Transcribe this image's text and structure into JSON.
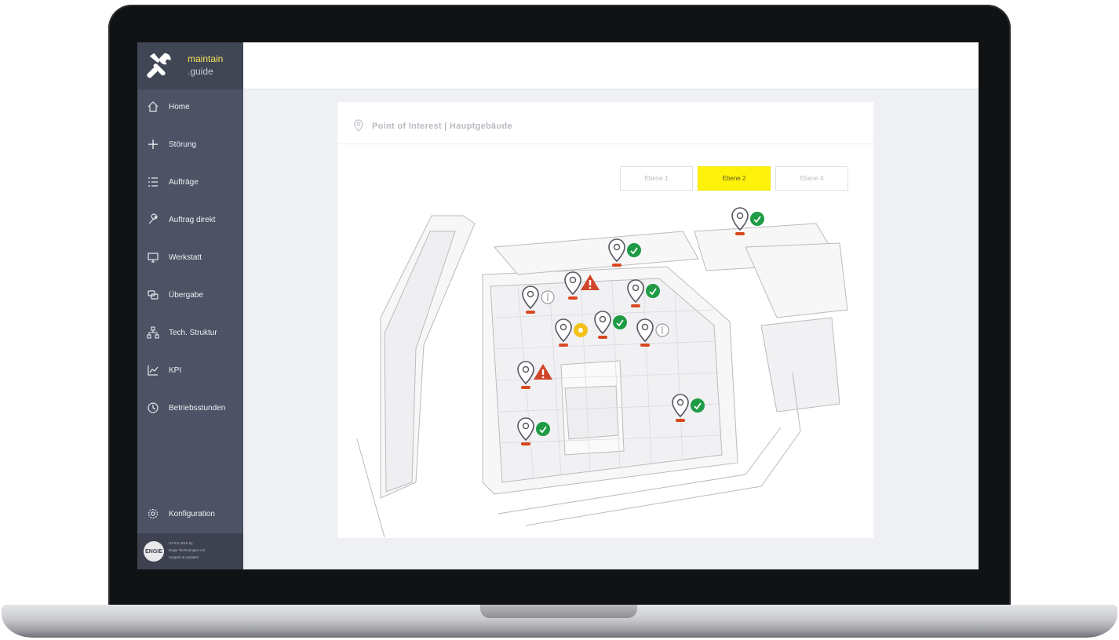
{
  "app": {
    "logo_line1": "maintain",
    "logo_line2": ".guide"
  },
  "sidebar": {
    "items": [
      {
        "label": "Home",
        "icon": "home-icon"
      },
      {
        "label": "Störung",
        "icon": "plus-icon"
      },
      {
        "label": "Aufträge",
        "icon": "list-icon"
      },
      {
        "label": "Auftrag direkt",
        "icon": "wrench-icon"
      },
      {
        "label": "Werkstatt",
        "icon": "monitor-icon"
      },
      {
        "label": "Übergabe",
        "icon": "handover-icon"
      },
      {
        "label": "Tech. Struktur",
        "icon": "hierarchy-icon"
      },
      {
        "label": "KPI",
        "icon": "chart-icon"
      },
      {
        "label": "Betriebsstunden",
        "icon": "clock-icon"
      }
    ],
    "config_label": "Konfiguration",
    "footer": {
      "logo_text": "ENGIE",
      "line1": "ST-8.5 2018 by",
      "line2": "Engie Technologies AG",
      "line3": "Support & Updates"
    }
  },
  "card": {
    "title": "Point of Interest | Hauptgebäude",
    "levels": [
      {
        "label": "Ebene 1",
        "active": false
      },
      {
        "label": "Ebene 2",
        "active": true
      },
      {
        "label": "Ebene 4",
        "active": false
      }
    ]
  },
  "map_markers": [
    {
      "status": "ok"
    },
    {
      "status": "ok"
    },
    {
      "status": "warning"
    },
    {
      "status": "idle"
    },
    {
      "status": "ok"
    },
    {
      "status": "pending"
    },
    {
      "status": "ok"
    },
    {
      "status": "idle"
    },
    {
      "status": "warning"
    },
    {
      "status": "ok"
    },
    {
      "status": "ok"
    }
  ],
  "colors": {
    "sidebar_bg": "#4d5264",
    "accent_yellow": "#fff20a",
    "status_ok": "#1f9b45",
    "status_warning": "#d0452a",
    "status_pending": "#f2c21a",
    "marker_badge": "#d9471f"
  }
}
